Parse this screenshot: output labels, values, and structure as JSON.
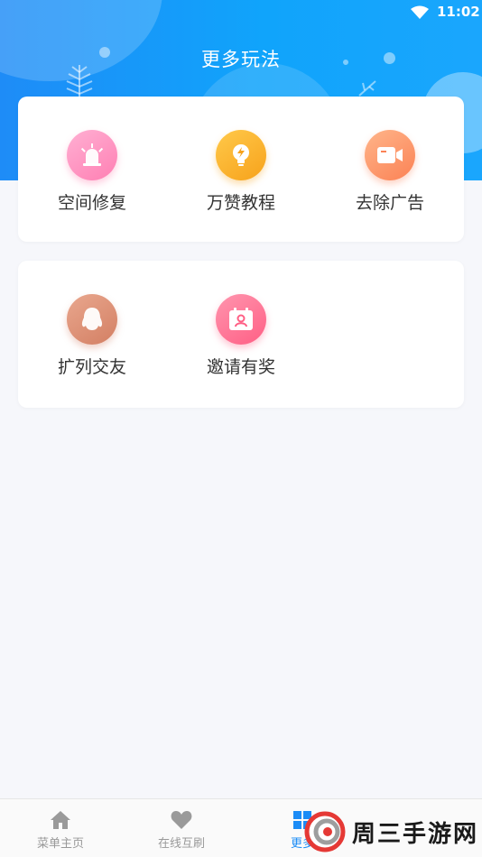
{
  "status_bar": {
    "time": "11:02"
  },
  "header": {
    "title": "更多玩法"
  },
  "cards": [
    {
      "items": [
        {
          "label": "空间修复",
          "icon": "siren-icon",
          "color": "#ff8fbf"
        },
        {
          "label": "万赞教程",
          "icon": "lightbulb-icon",
          "color": "#f9ae2c"
        },
        {
          "label": "去除广告",
          "icon": "video-camera-icon",
          "color": "#fd9366"
        }
      ]
    },
    {
      "items": [
        {
          "label": "扩列交友",
          "icon": "qq-penguin-icon",
          "color": "#de9076"
        },
        {
          "label": "邀请有奖",
          "icon": "calendar-user-icon",
          "color": "#ff7396"
        }
      ]
    }
  ],
  "bottom_nav": {
    "items": [
      {
        "label": "菜单主页",
        "icon": "home-icon",
        "active": false
      },
      {
        "label": "在线互刷",
        "icon": "heart-icon",
        "active": false
      },
      {
        "label": "更多",
        "icon": "grid-icon",
        "active": true
      }
    ],
    "active_color": "#1b8cf6"
  },
  "watermark": {
    "text": "周三手游网"
  }
}
